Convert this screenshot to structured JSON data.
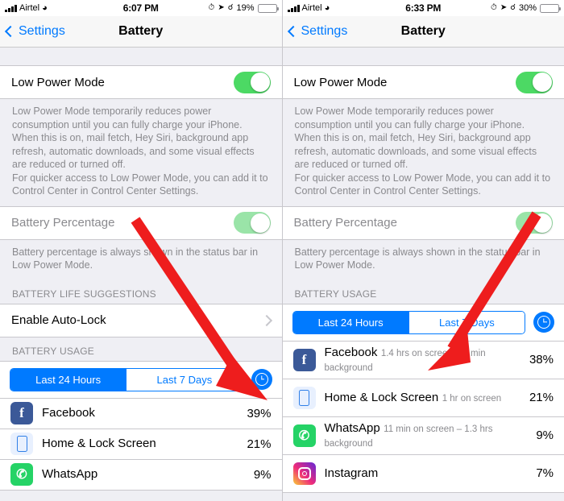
{
  "left": {
    "status_bar": {
      "carrier": "Airtel",
      "wifi_icon": "wifi-icon",
      "time": "6:07 PM",
      "alarm_icon": "alarm-icon",
      "location_icon": "location-arrow-icon",
      "bluetooth_icon": "bluetooth-icon",
      "battery_percent": "19%",
      "battery_fill_pct": 19
    },
    "nav": {
      "back_label": "Settings",
      "title": "Battery"
    },
    "low_power_mode": {
      "label": "Low Power Mode",
      "toggle_state": "on"
    },
    "low_power_footnote_1": "Low Power Mode temporarily reduces power consumption until you can fully charge your iPhone. When this is on, mail fetch, Hey Siri, background app refresh, automatic downloads, and some visual effects are reduced or turned off.",
    "low_power_footnote_2": "For quicker access to Low Power Mode, you can add it to Control Center in Control Center Settings.",
    "battery_percentage": {
      "label": "Battery Percentage",
      "toggle_state": "on-disabled"
    },
    "battery_percentage_footnote": "Battery percentage is always shown in the status bar in Low Power Mode.",
    "suggestions_header": "BATTERY LIFE SUGGESTIONS",
    "suggestion_row": {
      "label": "Enable Auto-Lock",
      "chevron": "chevron-right-icon"
    },
    "usage_header": "BATTERY USAGE",
    "segments": [
      {
        "label": "Last 24 Hours",
        "active": true
      },
      {
        "label": "Last 7 Days",
        "active": false
      }
    ],
    "clock_button_icon": "clock-icon",
    "apps": [
      {
        "name": "Facebook",
        "sub": "",
        "pct": "39%",
        "icon": "facebook-icon"
      },
      {
        "name": "Home & Lock Screen",
        "sub": "",
        "pct": "21%",
        "icon": "home-lock-screen-icon"
      },
      {
        "name": "WhatsApp",
        "sub": "",
        "pct": "9%",
        "icon": "whatsapp-icon"
      }
    ]
  },
  "right": {
    "status_bar": {
      "carrier": "Airtel",
      "wifi_icon": "wifi-icon",
      "time": "6:33 PM",
      "alarm_icon": "alarm-icon",
      "location_icon": "location-arrow-icon",
      "bluetooth_icon": "bluetooth-icon",
      "battery_percent": "30%",
      "battery_fill_pct": 30
    },
    "nav": {
      "back_label": "Settings",
      "title": "Battery"
    },
    "low_power_mode": {
      "label": "Low Power Mode",
      "toggle_state": "on"
    },
    "low_power_footnote_1": "Low Power Mode temporarily reduces power consumption until you can fully charge your iPhone. When this is on, mail fetch, Hey Siri, background app refresh, automatic downloads, and some visual effects are reduced or turned off.",
    "low_power_footnote_2": "For quicker access to Low Power Mode, you can add it to Control Center in Control Center Settings.",
    "battery_percentage": {
      "label": "Battery Percentage",
      "toggle_state": "on-disabled"
    },
    "battery_percentage_footnote": "Battery percentage is always shown in the status bar in Low Power Mode.",
    "usage_header": "BATTERY USAGE",
    "segments": [
      {
        "label": "Last 24 Hours",
        "active": true
      },
      {
        "label": "Last 7 Days",
        "active": false
      }
    ],
    "clock_button_icon": "clock-icon",
    "apps": [
      {
        "name": "Facebook",
        "sub": "1.4 hrs on screen – 2 min background",
        "pct": "38%",
        "icon": "facebook-icon"
      },
      {
        "name": "Home & Lock Screen",
        "sub": "1 hr on screen",
        "pct": "21%",
        "icon": "home-lock-screen-icon"
      },
      {
        "name": "WhatsApp",
        "sub": "11 min on screen – 1.3 hrs background",
        "pct": "9%",
        "icon": "whatsapp-icon"
      },
      {
        "name": "Instagram",
        "sub": "",
        "pct": "7%",
        "icon": "instagram-icon"
      }
    ]
  },
  "annotations": {
    "arrow_color": "#ee1d1d",
    "left_arrow_name": "red-arrow-pointing-to-clock-button",
    "right_arrow_name": "red-arrow-pointing-to-facebook-usage-detail"
  }
}
